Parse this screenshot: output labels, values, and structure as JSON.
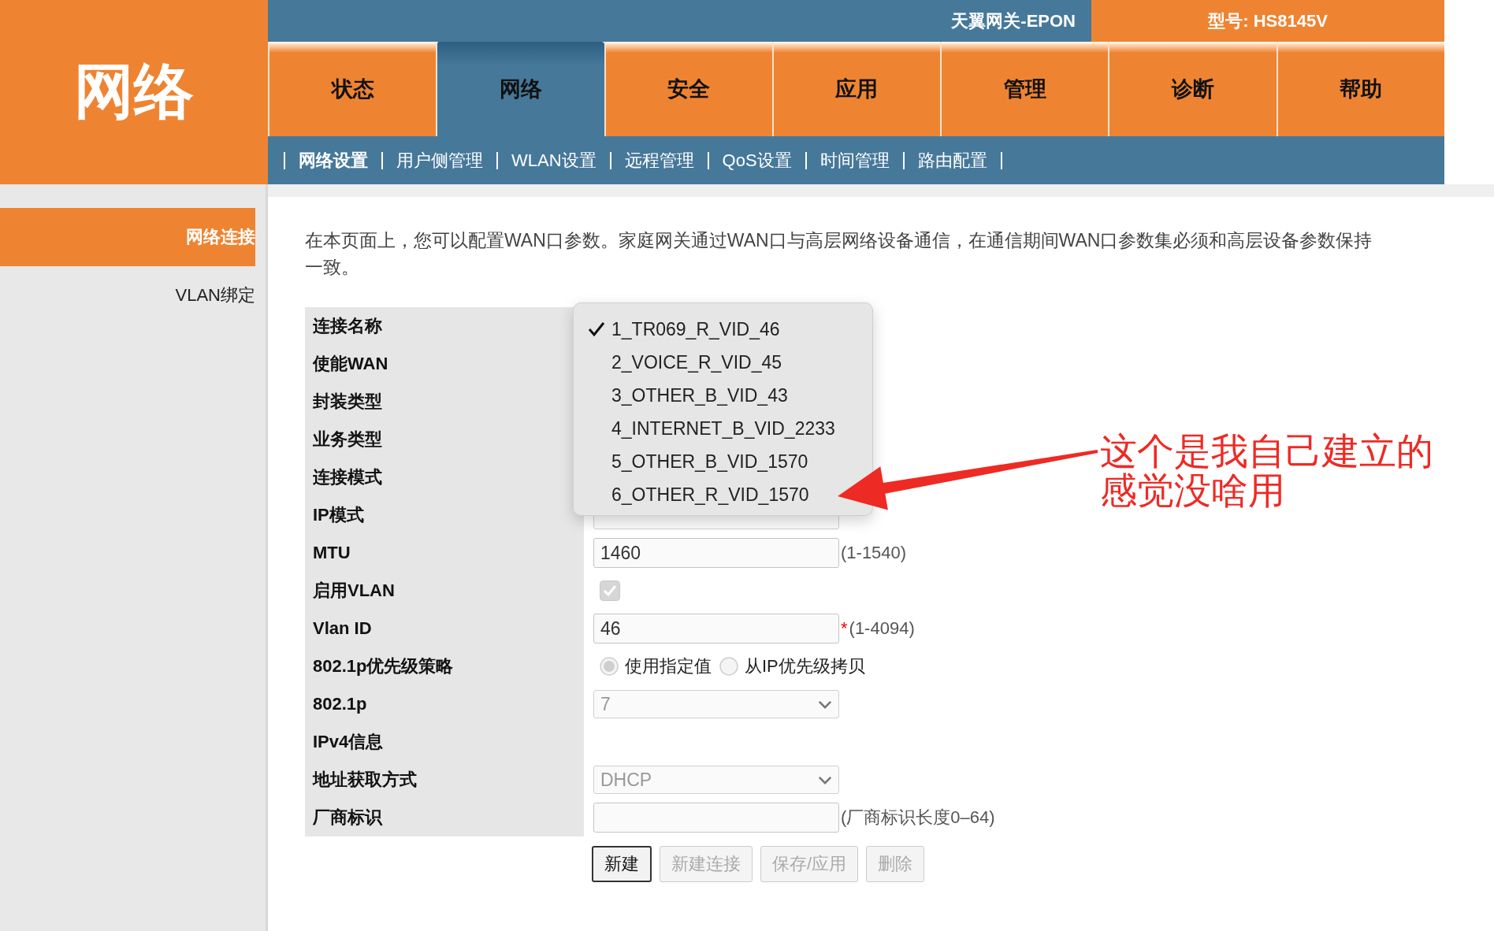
{
  "header": {
    "section_title": "网络",
    "gateway_label": "天翼网关-EPON",
    "model_label": "型号: HS8145V"
  },
  "tabs": [
    {
      "label": "状态",
      "selected": false
    },
    {
      "label": "网络",
      "selected": true
    },
    {
      "label": "安全",
      "selected": false
    },
    {
      "label": "应用",
      "selected": false
    },
    {
      "label": "管理",
      "selected": false
    },
    {
      "label": "诊断",
      "selected": false
    },
    {
      "label": "帮助",
      "selected": false
    }
  ],
  "subnav": [
    {
      "label": "网络设置",
      "selected": true
    },
    {
      "label": "用户侧管理",
      "selected": false
    },
    {
      "label": "WLAN设置",
      "selected": false
    },
    {
      "label": "远程管理",
      "selected": false
    },
    {
      "label": "QoS设置",
      "selected": false
    },
    {
      "label": "时间管理",
      "selected": false
    },
    {
      "label": "路由配置",
      "selected": false
    }
  ],
  "sidebar": [
    {
      "label": "网络连接",
      "selected": true
    },
    {
      "label": "VLAN绑定",
      "selected": false
    }
  ],
  "intro": "在本页面上，您可以配置WAN口参数。家庭网关通过WAN口与高层网络设备通信，在通信期间WAN口参数集必须和高层设备参数保持一致。",
  "form": {
    "rows": [
      {
        "label": "连接名称",
        "kind": "covered"
      },
      {
        "label": "使能WAN",
        "kind": "covered"
      },
      {
        "label": "封装类型",
        "kind": "covered"
      },
      {
        "label": "业务类型",
        "kind": "covered"
      },
      {
        "label": "连接模式",
        "kind": "covered"
      },
      {
        "label": "IP模式",
        "kind": "select"
      },
      {
        "label": "MTU",
        "kind": "text",
        "value": "1460",
        "hint": "(1-1540)"
      },
      {
        "label": "启用VLAN",
        "kind": "checkbox",
        "checked": true,
        "disabled": true
      },
      {
        "label": "Vlan ID",
        "kind": "text",
        "value": "46",
        "hint": "(1-4094)",
        "required_mark": "*"
      },
      {
        "label": "802.1p优先级策略",
        "kind": "radio",
        "options": [
          {
            "label": "使用指定值",
            "selected": true
          },
          {
            "label": "从IP优先级拷贝",
            "selected": false
          }
        ]
      },
      {
        "label": "802.1p",
        "kind": "select",
        "value": "7",
        "disabled": true
      },
      {
        "label": "IPv4信息",
        "kind": "heading"
      },
      {
        "label": "地址获取方式",
        "kind": "select",
        "value": "DHCP",
        "disabled": true
      },
      {
        "label": "厂商标识",
        "kind": "text",
        "hint": "(厂商标识长度0–64)"
      }
    ]
  },
  "buttons": [
    {
      "label": "新建",
      "disabled": false
    },
    {
      "label": "新建连接",
      "disabled": true
    },
    {
      "label": "保存/应用",
      "disabled": true
    },
    {
      "label": "删除",
      "disabled": true
    }
  ],
  "connection_dropdown": {
    "options": [
      {
        "label": "1_TR069_R_VID_46",
        "selected": true
      },
      {
        "label": "2_VOICE_R_VID_45",
        "selected": false
      },
      {
        "label": "3_OTHER_B_VID_43",
        "selected": false
      },
      {
        "label": "4_INTERNET_B_VID_2233",
        "selected": false
      },
      {
        "label": "5_OTHER_B_VID_1570",
        "selected": false
      },
      {
        "label": "6_OTHER_R_VID_1570",
        "selected": false
      }
    ]
  },
  "annotation": {
    "lines": [
      "这个是我自己建立的",
      "感觉没啥用"
    ]
  }
}
